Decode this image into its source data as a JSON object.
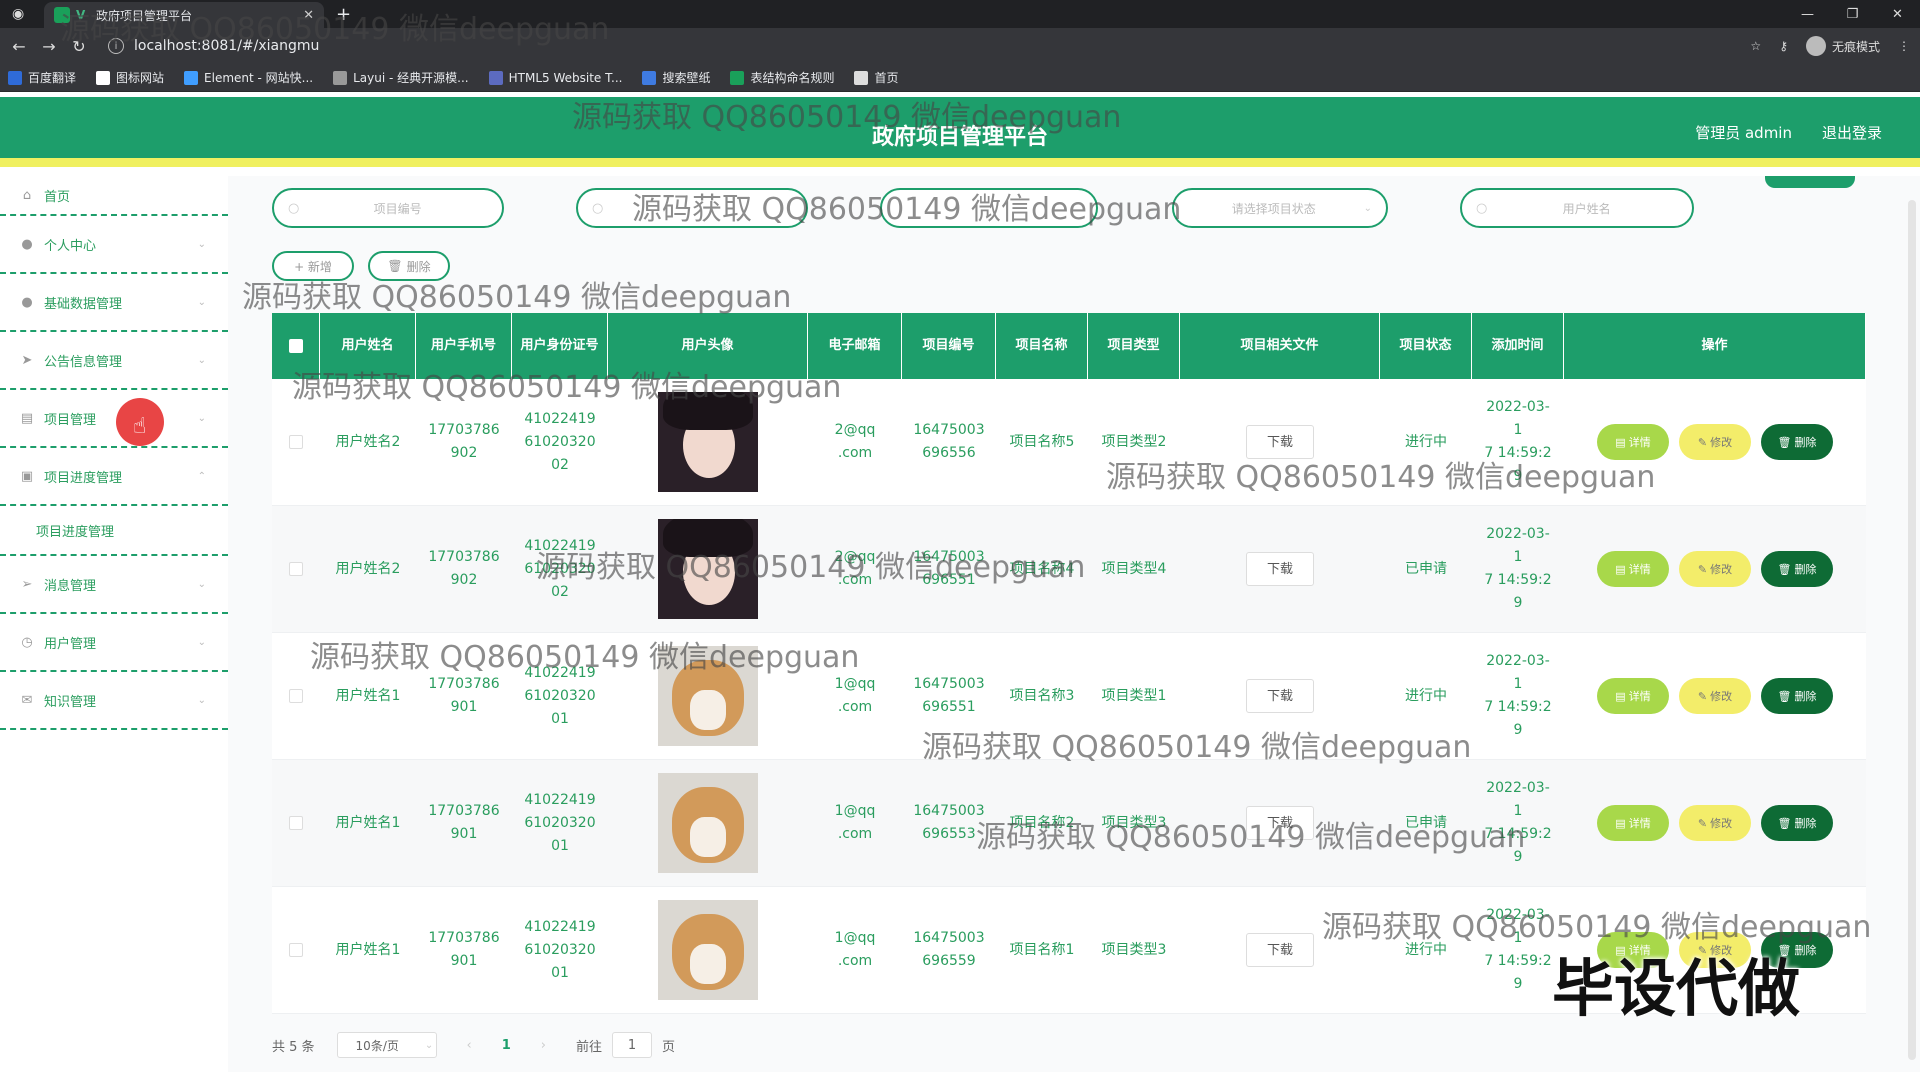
{
  "browser": {
    "tab_title": "政府项目管理平台",
    "url": "localhost:8081/#/xiangmu",
    "incognito_label": "无痕模式",
    "bookmarks": [
      {
        "label": "百度翻译",
        "color": "#2f6bd8"
      },
      {
        "label": "图标网站",
        "color": "#ffffff"
      },
      {
        "label": "Element - 网站快...",
        "color": "#409eff"
      },
      {
        "label": "Layui - 经典开源模...",
        "color": "#999999"
      },
      {
        "label": "HTML5 Website T...",
        "color": "#5c6bc0"
      },
      {
        "label": "搜索壁纸",
        "color": "#3f7be0"
      },
      {
        "label": "表结构命名规则",
        "color": "#1aa05a"
      },
      {
        "label": "首页",
        "color": "#dddddd"
      }
    ]
  },
  "header": {
    "title": "政府项目管理平台",
    "admin": "管理员 admin",
    "logout": "退出登录"
  },
  "sidebar": {
    "items": [
      {
        "label": "首页",
        "icon": "home-icon"
      },
      {
        "label": "个人中心",
        "icon": "person-icon"
      },
      {
        "label": "基础数据管理",
        "icon": "person-icon"
      },
      {
        "label": "公告信息管理",
        "icon": "send-icon"
      },
      {
        "label": "项目管理",
        "icon": "chat-icon"
      },
      {
        "label": "项目进度管理",
        "icon": "clipboard-icon"
      },
      {
        "label": "消息管理",
        "icon": "plane-icon"
      },
      {
        "label": "用户管理",
        "icon": "clock-icon"
      },
      {
        "label": "知识管理",
        "icon": "mail-icon"
      }
    ],
    "sub_item": "项目进度管理"
  },
  "search": {
    "project_no": "项目编号",
    "status": "请选择项目状态",
    "user_name": "用户姓名"
  },
  "actions": {
    "add": "+ 新增",
    "delete": "删除"
  },
  "table": {
    "headers": [
      "用户姓名",
      "用户手机号",
      "用户身份证号",
      "用户头像",
      "电子邮箱",
      "项目编号",
      "项目名称",
      "项目类型",
      "项目相关文件",
      "项目状态",
      "添加时间",
      "操作"
    ],
    "download_label": "下载",
    "op_labels": {
      "detail": "详情",
      "edit": "修改",
      "del": "删除"
    },
    "rows": [
      {
        "name": "用户姓名2",
        "phone": "17703786902",
        "idcard": "410224196102032002",
        "avatar": "girl",
        "email": "2@qq.com",
        "project_no": "16475003696556",
        "project_name": "项目名称5",
        "project_type": "项目类型2",
        "status": "进行中",
        "time": "2022-03-17 14:59:29"
      },
      {
        "name": "用户姓名2",
        "phone": "17703786902",
        "idcard": "410224196102032002",
        "avatar": "girl",
        "email": "2@qq.com",
        "project_no": "16475003696551",
        "project_name": "项目名称4",
        "project_type": "项目类型4",
        "status": "已申请",
        "time": "2022-03-17 14:59:29"
      },
      {
        "name": "用户姓名1",
        "phone": "17703786901",
        "idcard": "410224196102032001",
        "avatar": "dog",
        "email": "1@qq.com",
        "project_no": "16475003696551",
        "project_name": "项目名称3",
        "project_type": "项目类型1",
        "status": "进行中",
        "time": "2022-03-17 14:59:29"
      },
      {
        "name": "用户姓名1",
        "phone": "17703786901",
        "idcard": "410224196102032001",
        "avatar": "dog",
        "email": "1@qq.com",
        "project_no": "16475003696553",
        "project_name": "项目名称2",
        "project_type": "项目类型3",
        "status": "已申请",
        "time": "2022-03-17 14:59:29"
      },
      {
        "name": "用户姓名1",
        "phone": "17703786901",
        "idcard": "410224196102032001",
        "avatar": "dog",
        "email": "1@qq.com",
        "project_no": "16475003696559",
        "project_name": "项目名称1",
        "project_type": "项目类型3",
        "status": "进行中",
        "time": "2022-03-17 14:59:29"
      }
    ]
  },
  "pagination": {
    "total": "共 5 条",
    "page_size": "10条/页",
    "current": "1",
    "goto_prefix": "前往",
    "goto_value": "1",
    "goto_suffix": "页"
  },
  "watermark": "源码获取 QQ86050149 微信deepguan",
  "stamp": "毕设代做"
}
